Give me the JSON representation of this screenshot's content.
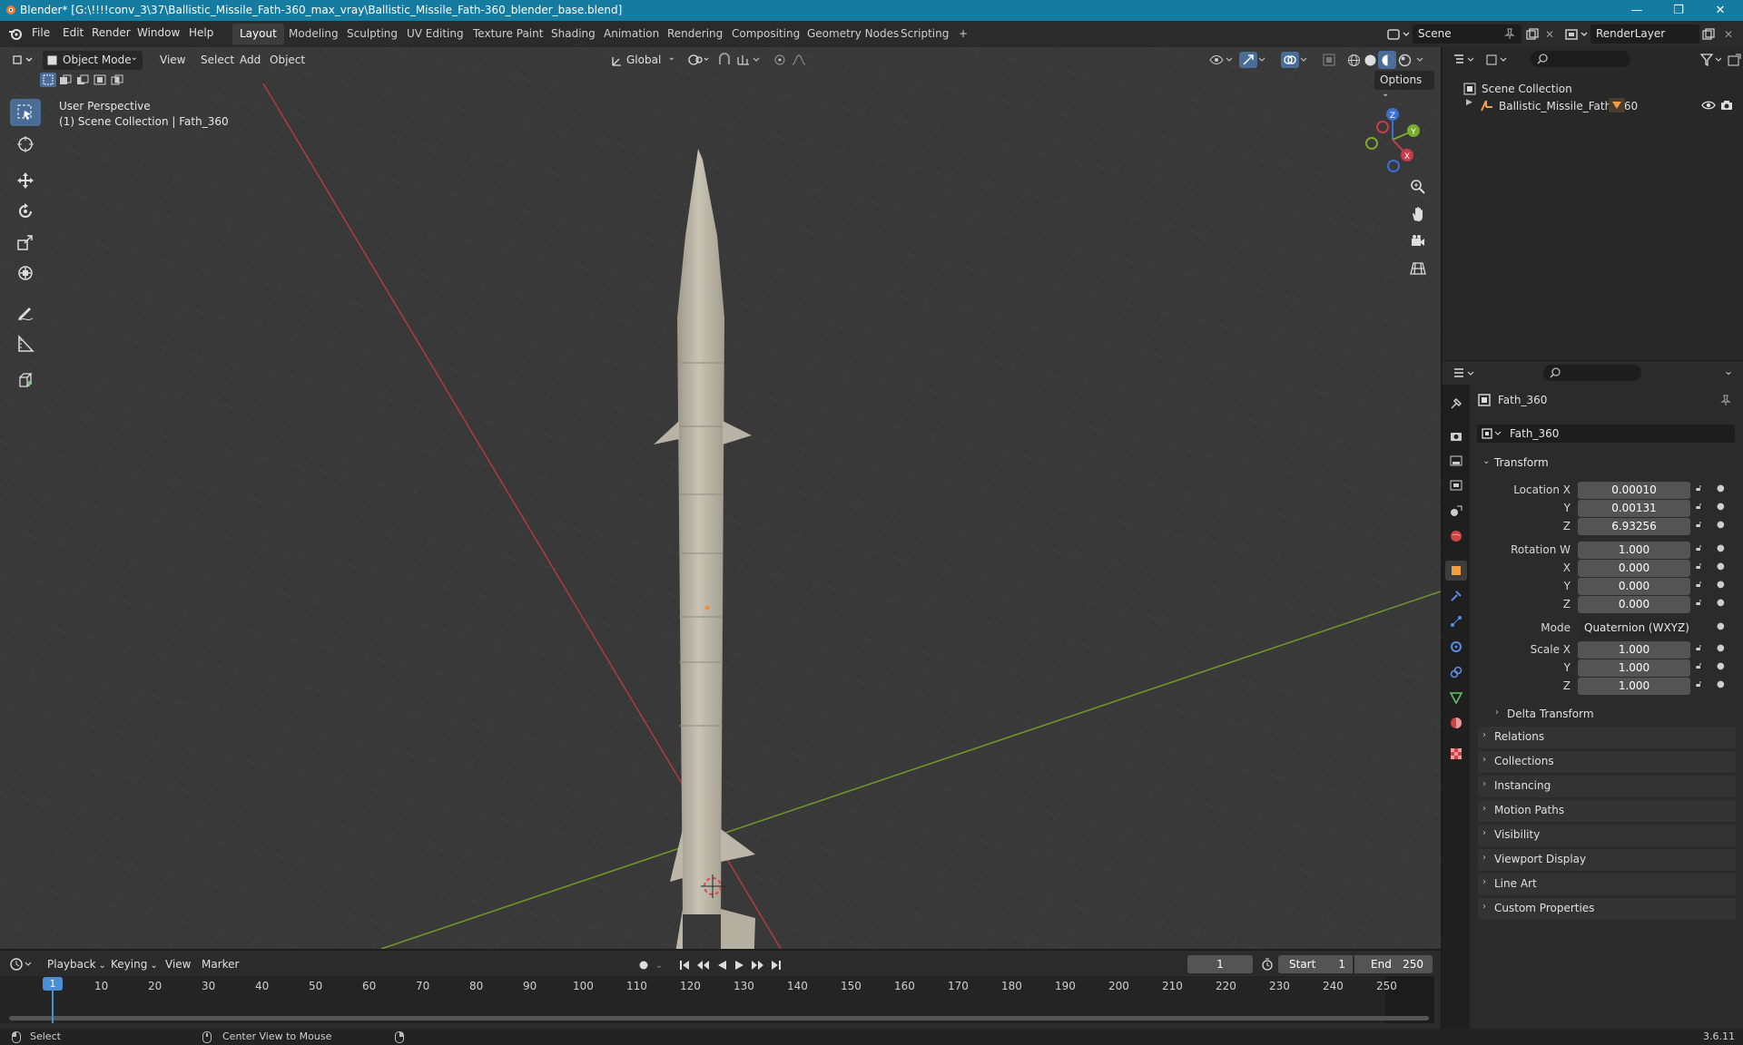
{
  "window": {
    "title": "Blender* [G:\\!!!!conv_3\\37\\Ballistic_Missile_Fath-360_max_vray\\Ballistic_Missile_Fath-360_blender_base.blend]",
    "minimize": "—",
    "maximize": "❐",
    "close": "✕"
  },
  "menu": [
    "File",
    "Edit",
    "Render",
    "Window",
    "Help"
  ],
  "workspaces": [
    "Layout",
    "Modeling",
    "Sculpting",
    "UV Editing",
    "Texture Paint",
    "Shading",
    "Animation",
    "Rendering",
    "Compositing",
    "Geometry Nodes",
    "Scripting",
    "+"
  ],
  "scene": {
    "name": "Scene",
    "render_layer": "RenderLayer"
  },
  "viewport": {
    "mode": "Object Mode",
    "menus": [
      "View",
      "Select",
      "Add",
      "Object"
    ],
    "transform_orientation": "Global",
    "options": "Options",
    "perspective": "User Perspective",
    "collection_info": "(1) Scene Collection | Fath_360",
    "gizmo": {
      "x": "X",
      "y": "Y",
      "z": "Z"
    }
  },
  "outliner": {
    "root": "Scene Collection",
    "items": [
      {
        "label": "Ballistic_Missile_Fath_360"
      }
    ]
  },
  "properties": {
    "object_name": "Fath_360",
    "datablock": "Fath_360",
    "transform_title": "Transform",
    "location": {
      "label": "Location X",
      "x": "0.00010",
      "y": "0.00131",
      "z": "6.93256"
    },
    "rotation": {
      "label": "Rotation W",
      "w": "1.000",
      "x": "0.000",
      "y": "0.000",
      "z": "0.000"
    },
    "mode_label": "Mode",
    "mode_value": "Quaternion (WXYZ)",
    "scale": {
      "label": "Scale X",
      "x": "1.000",
      "y": "1.000",
      "z": "1.000"
    },
    "axis_labels": {
      "y": "Y",
      "z": "Z",
      "x": "X"
    },
    "delta": "Delta Transform",
    "panels": [
      "Relations",
      "Collections",
      "Instancing",
      "Motion Paths",
      "Visibility",
      "Viewport Display",
      "Line Art",
      "Custom Properties"
    ]
  },
  "timeline": {
    "menus": [
      "Playback",
      "Keying",
      "View",
      "Marker"
    ],
    "current_frame": "1",
    "start_label": "Start",
    "start": "1",
    "end_label": "End",
    "end": "250",
    "ticks": [
      "1",
      "10",
      "20",
      "30",
      "40",
      "50",
      "60",
      "70",
      "80",
      "90",
      "100",
      "110",
      "120",
      "130",
      "140",
      "150",
      "160",
      "170",
      "180",
      "190",
      "200",
      "210",
      "220",
      "230",
      "240",
      "250"
    ]
  },
  "status": {
    "select": "Select",
    "center": "Center View to Mouse",
    "version": "3.6.11"
  }
}
